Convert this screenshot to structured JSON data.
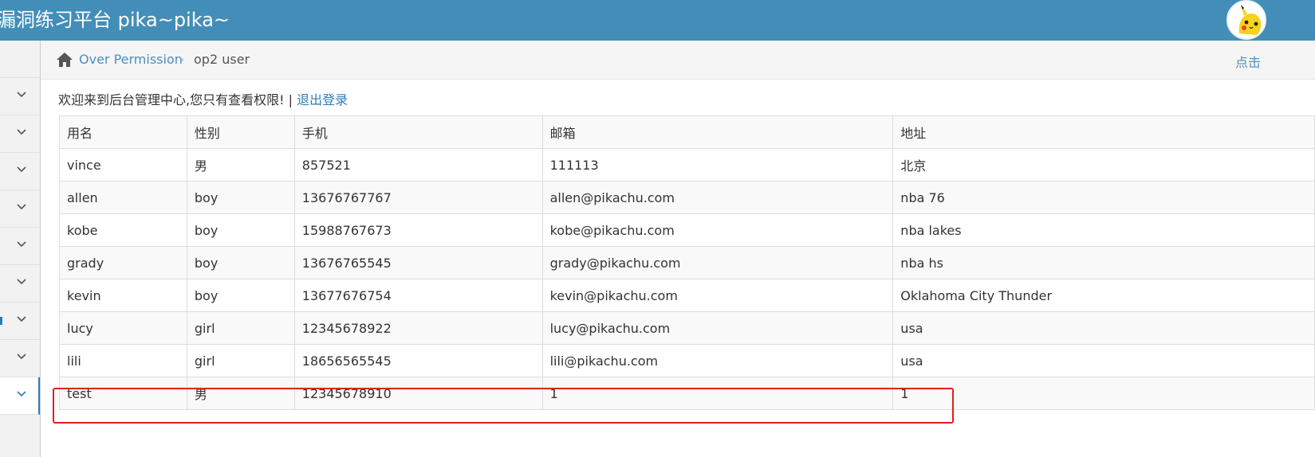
{
  "header": {
    "brand": "漏洞练习平台 pika~pika~",
    "avatar_icon": "pikachu-avatar-icon"
  },
  "breadcrumb": {
    "home_icon": "home-icon",
    "section": "Over Permission",
    "separator": "›",
    "current": "op2 user",
    "right_link": "点击"
  },
  "sidebar": {
    "items": [
      {
        "icon": "chevron-down-icon",
        "active": false
      },
      {
        "icon": "chevron-down-icon",
        "active": false
      },
      {
        "icon": "chevron-down-icon",
        "active": false
      },
      {
        "icon": "chevron-down-icon",
        "active": false
      },
      {
        "icon": "chevron-down-icon",
        "active": false
      },
      {
        "icon": "chevron-down-icon",
        "active": false
      },
      {
        "icon": "chevron-down-icon",
        "active": false
      },
      {
        "icon": "chevron-down-icon",
        "active": false
      },
      {
        "icon": "chevron-down-icon",
        "active": true
      }
    ]
  },
  "main": {
    "welcome_text": "欢迎来到后台管理中心,您只有查看权限! | ",
    "logout_link": "退出登录",
    "table": {
      "headers": [
        "用名",
        "性别",
        "手机",
        "邮箱",
        "地址"
      ],
      "rows": [
        [
          "vince",
          "男",
          "857521",
          "111113",
          "北京"
        ],
        [
          "allen",
          "boy",
          "13676767767",
          "allen@pikachu.com",
          "nba 76"
        ],
        [
          "kobe",
          "boy",
          "15988767673",
          "kobe@pikachu.com",
          "nba lakes"
        ],
        [
          "grady",
          "boy",
          "13676765545",
          "grady@pikachu.com",
          "nba hs"
        ],
        [
          "kevin",
          "boy",
          "13677676754",
          "kevin@pikachu.com",
          "Oklahoma City Thunder"
        ],
        [
          "lucy",
          "girl",
          "12345678922",
          "lucy@pikachu.com",
          "usa"
        ],
        [
          "lili",
          "girl",
          "18656565545",
          "lili@pikachu.com",
          "usa"
        ],
        [
          "test",
          "男",
          "12345678910",
          "1",
          "1"
        ]
      ]
    }
  },
  "colors": {
    "navbar": "#438eb9",
    "link": "#4c8fbd",
    "highlight": "#e02020"
  }
}
